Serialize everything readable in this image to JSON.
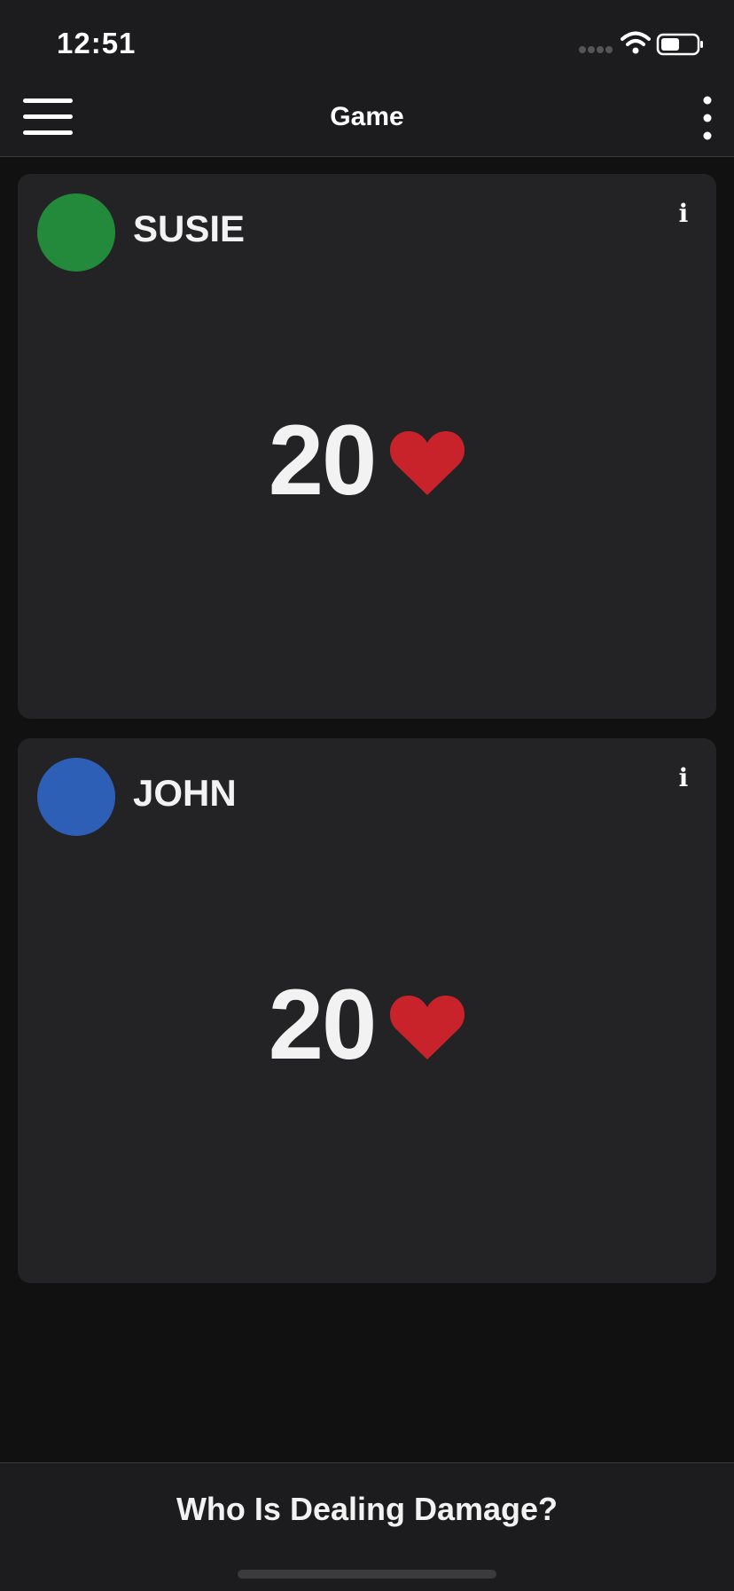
{
  "status_bar": {
    "time": "12:51"
  },
  "nav": {
    "title": "Game"
  },
  "players": [
    {
      "name": "SUSIE",
      "life": "20",
      "color": "#228a3a"
    },
    {
      "name": "JOHN",
      "life": "20",
      "color": "#2e5fb7"
    }
  ],
  "info_glyph": "i",
  "heart_color": "#c8232a",
  "bottom": {
    "action_label": "Who Is Dealing Damage?"
  }
}
